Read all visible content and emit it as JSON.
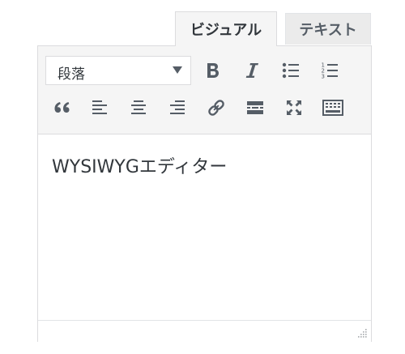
{
  "tabs": {
    "visual_label": "ビジュアル",
    "text_label": "テキスト"
  },
  "toolbar": {
    "format_select": {
      "selected": "段落"
    },
    "row1": [
      {
        "name": "bold",
        "icon": "bold-icon"
      },
      {
        "name": "italic",
        "icon": "italic-icon"
      },
      {
        "name": "bullet-list",
        "icon": "bullet-list-icon"
      },
      {
        "name": "numbered-list",
        "icon": "numbered-list-icon"
      }
    ],
    "row2": [
      {
        "name": "blockquote",
        "icon": "blockquote-icon"
      },
      {
        "name": "align-left",
        "icon": "align-left-icon"
      },
      {
        "name": "align-center",
        "icon": "align-center-icon"
      },
      {
        "name": "align-right",
        "icon": "align-right-icon"
      },
      {
        "name": "insert-link",
        "icon": "link-icon"
      },
      {
        "name": "read-more",
        "icon": "read-more-icon"
      },
      {
        "name": "fullscreen",
        "icon": "fullscreen-icon"
      },
      {
        "name": "toolbar-toggle",
        "icon": "keyboard-icon"
      }
    ]
  },
  "editor": {
    "content": "WYSIWYGエディター"
  },
  "colors": {
    "toolbar_bg": "#f5f5f5",
    "icon": "#555d66",
    "border": "#dcdcde",
    "text": "#32373c"
  }
}
